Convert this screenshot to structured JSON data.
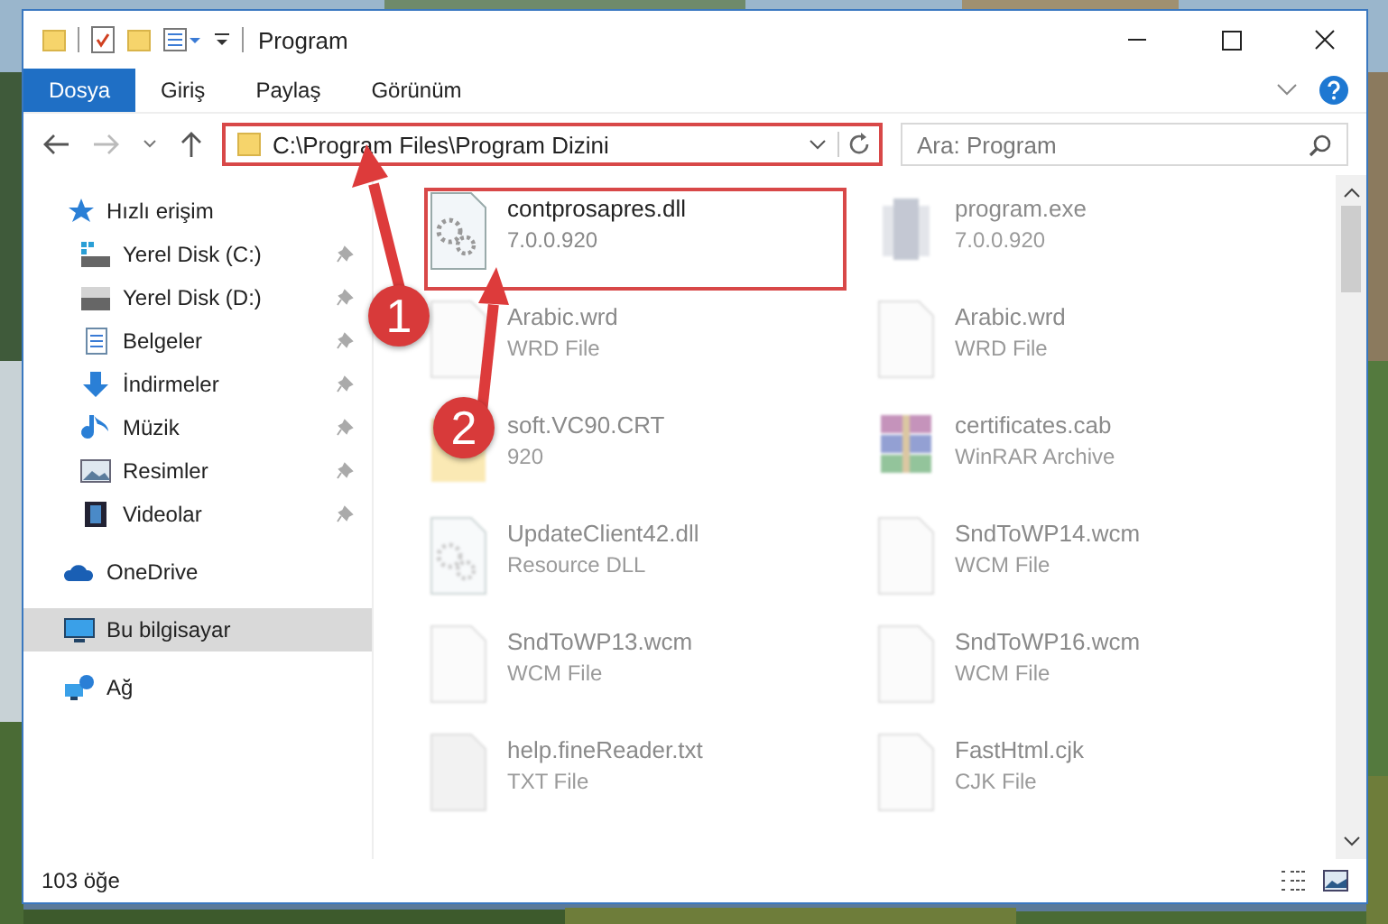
{
  "window": {
    "title": "Program"
  },
  "ribbon_tabs": [
    {
      "label": "Dosya",
      "selected": true
    },
    {
      "label": "Giriş",
      "selected": false
    },
    {
      "label": "Paylaş",
      "selected": false
    },
    {
      "label": "Görünüm",
      "selected": false
    }
  ],
  "address": {
    "value": "C:\\Program Files\\Program Dizini"
  },
  "search": {
    "placeholder": "Ara: Program"
  },
  "sidebar": {
    "items": [
      {
        "label": "Hızlı erişim",
        "kind": "star",
        "selected": false,
        "children": [
          {
            "label": "Yerel Disk (C:)",
            "kind": "windrive",
            "pinned": true,
            "selected": false
          },
          {
            "label": "Yerel Disk (D:)",
            "kind": "drive",
            "pinned": true,
            "selected": false
          },
          {
            "label": "Belgeler",
            "kind": "docs",
            "pinned": true,
            "selected": false
          },
          {
            "label": "İndirmeler",
            "kind": "download",
            "pinned": true,
            "selected": false
          },
          {
            "label": "Müzik",
            "kind": "music",
            "pinned": true,
            "selected": false
          },
          {
            "label": "Resimler",
            "kind": "pictures",
            "pinned": true,
            "selected": false
          },
          {
            "label": "Videolar",
            "kind": "video",
            "pinned": true,
            "selected": false
          }
        ]
      },
      {
        "label": "OneDrive",
        "kind": "cloud",
        "selected": false
      },
      {
        "label": "Bu bilgisayar",
        "kind": "pc",
        "selected": true
      },
      {
        "label": "Ağ",
        "kind": "network",
        "selected": false
      }
    ]
  },
  "files": [
    {
      "name": "contprosapres.dll",
      "detail": "7.0.0.920",
      "kind": "dll",
      "faded": false
    },
    {
      "name": "program.exe",
      "detail": "7.0.0.920",
      "kind": "exe",
      "faded": true
    },
    {
      "name": "Arabic.wrd",
      "detail": "WRD File",
      "kind": "doc",
      "faded": true
    },
    {
      "name": "Arabic.wrd",
      "detail": "WRD File",
      "kind": "doc",
      "faded": true
    },
    {
      "name": "soft.VC90.CRT",
      "detail": "920",
      "kind": "folder",
      "faded": true
    },
    {
      "name": "certificates.cab",
      "detail": "WinRAR Archive",
      "kind": "rar",
      "faded": true
    },
    {
      "name": "UpdateClient42.dll",
      "detail": "Resource DLL",
      "kind": "dll",
      "faded": true
    },
    {
      "name": "SndToWP14.wcm",
      "detail": "WCM File",
      "kind": "doc",
      "faded": true
    },
    {
      "name": "SndToWP13.wcm",
      "detail": "WCM File",
      "kind": "doc",
      "faded": true
    },
    {
      "name": "SndToWP16.wcm",
      "detail": "WCM File",
      "kind": "doc",
      "faded": true
    },
    {
      "name": "help.fineReader.txt",
      "detail": "TXT File",
      "kind": "txt",
      "faded": true
    },
    {
      "name": "FastHtml.cjk",
      "detail": "CJK File",
      "kind": "doc",
      "faded": true
    }
  ],
  "status_bar": {
    "count": "103 öğe"
  },
  "annotations": [
    {
      "number": "1"
    },
    {
      "number": "2"
    }
  ]
}
